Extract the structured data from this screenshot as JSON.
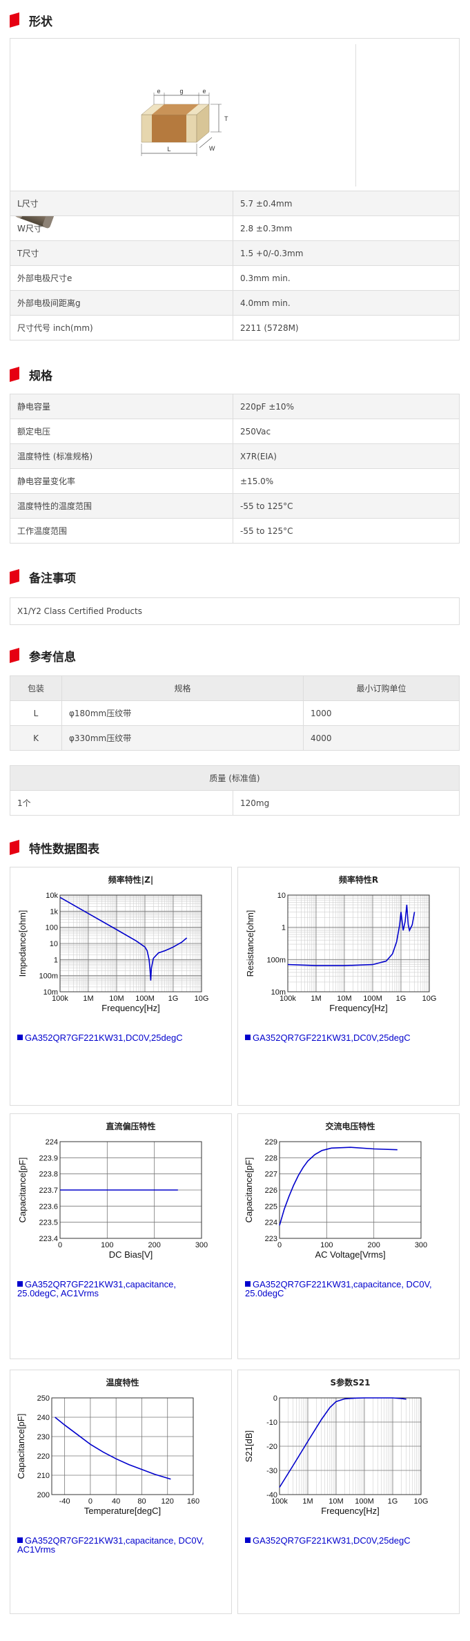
{
  "sections": {
    "shape": "形状",
    "spec": "规格",
    "notes": "备注事项",
    "ref": "参考信息",
    "charts": "特性数据图表"
  },
  "shape": {
    "dim_labels": {
      "e1": "e",
      "g": "g",
      "e2": "e",
      "t": "T",
      "w": "W",
      "l": "L"
    },
    "rows": [
      {
        "label": "L尺寸",
        "value": "5.7 ±0.4mm"
      },
      {
        "label": "W尺寸",
        "value": "2.8 ±0.3mm"
      },
      {
        "label": "T尺寸",
        "value": "1.5 +0/-0.3mm"
      },
      {
        "label": "外部电极尺寸e",
        "value": "0.3mm min."
      },
      {
        "label": "外部电极间距离g",
        "value": "4.0mm min."
      },
      {
        "label": "尺寸代号 inch(mm)",
        "value": "2211 (5728M)"
      }
    ]
  },
  "spec": {
    "rows": [
      {
        "label": "静电容量",
        "value": "220pF ±10%"
      },
      {
        "label": "额定电压",
        "value": "250Vac"
      },
      {
        "label": "温度特性 (标准规格)",
        "value": "X7R(EIA)"
      },
      {
        "label": "静电容量变化率",
        "value": "±15.0%"
      },
      {
        "label": "温度特性的温度范围",
        "value": "-55 to 125°C"
      },
      {
        "label": "工作温度范围",
        "value": "-55 to 125°C"
      }
    ]
  },
  "notes": {
    "text": "X1/Y2 Class Certified Products"
  },
  "ref": {
    "headers": [
      "包装",
      "规格",
      "最小订购单位"
    ],
    "rows": [
      [
        "L",
        "φ180mm压纹带",
        "1000"
      ],
      [
        "K",
        "φ330mm压纹带",
        "4000"
      ]
    ],
    "mass_header": "质量 (标准值)",
    "mass_row": [
      "1个",
      "120mg"
    ]
  },
  "chart_data": [
    {
      "type": "line",
      "title": "频率特性|Z|",
      "xlabel": "Frequency[Hz]",
      "ylabel": "Impedance[ohm]",
      "xscale": "log",
      "yscale": "log",
      "xlim": [
        100000,
        10000000000
      ],
      "ylim": [
        0.01,
        10000
      ],
      "xticks": [
        "100k",
        "1M",
        "10M",
        "100M",
        "1G",
        "10G"
      ],
      "yticks": [
        "10m",
        "100m",
        "1",
        "10",
        "100",
        "1k",
        "10k"
      ],
      "legend": "GA352QR7GF221KW31,DC0V,25degC",
      "grid": true,
      "series": [
        {
          "points": [
            [
              100000,
              7200
            ],
            [
              1000000,
              720
            ],
            [
              10000000,
              72
            ],
            [
              50000000,
              14
            ],
            [
              100000000,
              6
            ],
            [
              120000000,
              3.5
            ],
            [
              140000000,
              1
            ],
            [
              150000000,
              0.3
            ],
            [
              160000000,
              0.05
            ],
            [
              170000000,
              0.3
            ],
            [
              200000000,
              1.2
            ],
            [
              300000000,
              2.6
            ],
            [
              500000000,
              3.5
            ],
            [
              700000000,
              4.5
            ],
            [
              1000000000,
              6
            ],
            [
              1500000000,
              9
            ],
            [
              2000000000,
              12
            ],
            [
              3000000000,
              22
            ]
          ]
        }
      ]
    },
    {
      "type": "line",
      "title": "频率特性R",
      "xlabel": "Frequency[Hz]",
      "ylabel": "Resistance[ohm]",
      "xscale": "log",
      "yscale": "log",
      "xlim": [
        100000,
        10000000000
      ],
      "ylim": [
        0.01,
        10
      ],
      "xticks": [
        "100k",
        "1M",
        "10M",
        "100M",
        "1G",
        "10G"
      ],
      "yticks": [
        "10m",
        "100m",
        "1",
        "10"
      ],
      "legend": "GA352QR7GF221KW31,DC0V,25degC",
      "grid": true,
      "series": [
        {
          "points": [
            [
              100000,
              0.07
            ],
            [
              1000000,
              0.065
            ],
            [
              10000000,
              0.065
            ],
            [
              100000000,
              0.07
            ],
            [
              300000000,
              0.09
            ],
            [
              500000000,
              0.15
            ],
            [
              700000000,
              0.35
            ],
            [
              900000000,
              1.2
            ],
            [
              1000000000,
              3
            ],
            [
              1100000000,
              1.5
            ],
            [
              1200000000,
              0.8
            ],
            [
              1400000000,
              1.5
            ],
            [
              1600000000,
              5
            ],
            [
              1800000000,
              1.2
            ],
            [
              2000000000,
              0.8
            ],
            [
              2500000000,
              1.2
            ],
            [
              3000000000,
              3
            ]
          ]
        }
      ]
    },
    {
      "type": "line",
      "title": "直流偏压特性",
      "xlabel": "DC Bias[V]",
      "ylabel": "Capacitance[pF]",
      "xlim": [
        0,
        300
      ],
      "ylim": [
        223.4,
        224
      ],
      "xticks": [
        "0",
        "100",
        "200",
        "300"
      ],
      "yticks": [
        "223.4",
        "223.5",
        "223.6",
        "223.7",
        "223.8",
        "223.9",
        "224"
      ],
      "legend": "GA352QR7GF221KW31,capacitance, 25.0degC, AC1Vrms",
      "grid": true,
      "series": [
        {
          "points": [
            [
              0,
              223.7
            ],
            [
              250,
              223.7
            ]
          ]
        }
      ]
    },
    {
      "type": "line",
      "title": "交流电压特性",
      "xlabel": "AC Voltage[Vrms]",
      "ylabel": "Capacitance[pF]",
      "xlim": [
        0,
        300
      ],
      "ylim": [
        223,
        229
      ],
      "xticks": [
        "0",
        "100",
        "200",
        "300"
      ],
      "yticks": [
        "223",
        "224",
        "225",
        "226",
        "227",
        "228",
        "229"
      ],
      "legend": "GA352QR7GF221KW31,capacitance, DC0V, 25.0degC",
      "grid": true,
      "series": [
        {
          "points": [
            [
              0,
              223.8
            ],
            [
              10,
              224.8
            ],
            [
              20,
              225.6
            ],
            [
              30,
              226.3
            ],
            [
              40,
              226.9
            ],
            [
              50,
              227.4
            ],
            [
              60,
              227.8
            ],
            [
              75,
              228.2
            ],
            [
              90,
              228.45
            ],
            [
              110,
              228.6
            ],
            [
              150,
              228.65
            ],
            [
              200,
              228.55
            ],
            [
              250,
              228.5
            ]
          ]
        }
      ]
    },
    {
      "type": "line",
      "title": "温度特性",
      "xlabel": "Temperature[degC]",
      "ylabel": "Capacitance[pF]",
      "xlim": [
        -60,
        160
      ],
      "ylim": [
        200,
        250
      ],
      "xticks": [
        "-40",
        "0",
        "40",
        "80",
        "120",
        "160"
      ],
      "yticks": [
        "200",
        "210",
        "220",
        "230",
        "240",
        "250"
      ],
      "legend": "GA352QR7GF221KW31,capacitance, DC0V, AC1Vrms",
      "grid": true,
      "series": [
        {
          "points": [
            [
              -55,
              240
            ],
            [
              -40,
              236
            ],
            [
              -20,
              231
            ],
            [
              0,
              226
            ],
            [
              20,
              222
            ],
            [
              40,
              218.5
            ],
            [
              60,
              215.5
            ],
            [
              80,
              213
            ],
            [
              100,
              210.5
            ],
            [
              125,
              208
            ]
          ]
        }
      ]
    },
    {
      "type": "line",
      "title": "S参数S21",
      "xlabel": "Frequency[Hz]",
      "ylabel": "S21[dB]",
      "xscale": "log",
      "xlim": [
        100000,
        10000000000
      ],
      "ylim": [
        -40,
        0
      ],
      "xticks": [
        "100k",
        "1M",
        "10M",
        "100M",
        "1G",
        "10G"
      ],
      "yticks": [
        "-40",
        "-30",
        "-20",
        "-10",
        "0"
      ],
      "legend": "GA352QR7GF221KW31,DC0V,25degC",
      "grid": true,
      "series": [
        {
          "points": [
            [
              100000,
              -37
            ],
            [
              300000,
              -28
            ],
            [
              1000000,
              -18
            ],
            [
              3000000,
              -9
            ],
            [
              6000000,
              -4
            ],
            [
              10000000,
              -1.5
            ],
            [
              20000000,
              -0.4
            ],
            [
              50000000,
              -0.1
            ],
            [
              100000000,
              0
            ],
            [
              1000000000,
              0
            ],
            [
              2000000000,
              -0.3
            ],
            [
              3000000000,
              -0.5
            ]
          ]
        }
      ]
    }
  ]
}
